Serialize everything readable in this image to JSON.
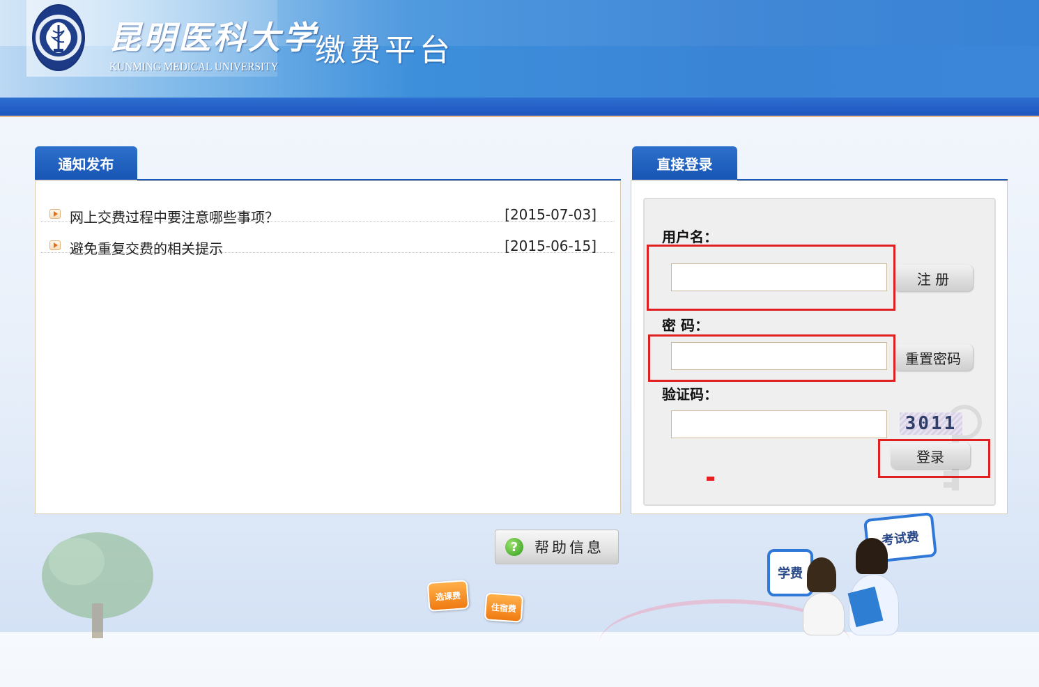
{
  "header": {
    "university_cn": "昆明医科大学",
    "university_en": "KUNMING MEDICAL UNIVERSITY",
    "platform_title": "缴费平台"
  },
  "notice": {
    "tab_label": "通知发布",
    "items": [
      {
        "title": "网上交费过程中要注意哪些事项？",
        "date": "[2015-07-03]"
      },
      {
        "title": "避免重复交费的相关提示",
        "date": "[2015-06-15]"
      }
    ]
  },
  "login": {
    "tab_label": "直接登录",
    "username_label": "用户名：",
    "username_value": "",
    "register_button": "注 册",
    "password_label": "密 码：",
    "password_value": "",
    "reset_password_button": "重置密码",
    "captcha_label": "验证码：",
    "captcha_value": "",
    "captcha_image_text": "3011",
    "login_button": "登录"
  },
  "help": {
    "button_label": "帮助信息",
    "icon_glyph": "?"
  },
  "decor": {
    "tag_course_fee": "选课费",
    "tag_dorm_fee": "住宿费",
    "tag_tuition": "学费",
    "tag_exam_fee": "考试费"
  },
  "colors": {
    "header_blue": "#3a84d6",
    "tab_blue": "#1855b4",
    "highlight_red": "#e02020"
  }
}
